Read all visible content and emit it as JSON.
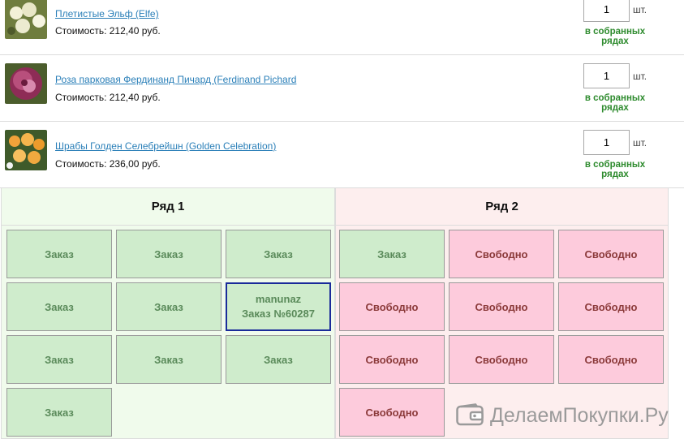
{
  "products": [
    {
      "name": "Плетистые Эльф (Elfe)",
      "price": "Стоимость: 212,40 руб.",
      "qty": "1",
      "unit": "шт.",
      "status_line1": "в собранных",
      "status_line2": "рядах"
    },
    {
      "name": "Роза парковая Фердинанд Пичард (Ferdinand Pichard",
      "price": "Стоимость: 212,40 руб.",
      "qty": "1",
      "unit": "шт.",
      "status_line1": "в собранных",
      "status_line2": "рядах"
    },
    {
      "name": "Шрабы Голден Селебрейшн (Golden Celebration)",
      "price": "Стоимость: 236,00 руб.",
      "qty": "1",
      "unit": "шт.",
      "status_line1": "в собранных",
      "status_line2": "рядах"
    }
  ],
  "rows": [
    {
      "title": "Ряд 1",
      "cells": [
        {
          "type": "order",
          "label": "Заказ"
        },
        {
          "type": "order",
          "label": "Заказ"
        },
        {
          "type": "order",
          "label": "Заказ"
        },
        {
          "type": "order",
          "label": "Заказ"
        },
        {
          "type": "order",
          "label": "Заказ"
        },
        {
          "type": "mine",
          "user": "manunaz",
          "label": "Заказ №60287"
        },
        {
          "type": "order",
          "label": "Заказ"
        },
        {
          "type": "order",
          "label": "Заказ"
        },
        {
          "type": "order",
          "label": "Заказ"
        },
        {
          "type": "order",
          "label": "Заказ"
        }
      ]
    },
    {
      "title": "Ряд 2",
      "cells": [
        {
          "type": "order",
          "label": "Заказ"
        },
        {
          "type": "free",
          "label": "Свободно"
        },
        {
          "type": "free",
          "label": "Свободно"
        },
        {
          "type": "free",
          "label": "Свободно"
        },
        {
          "type": "free",
          "label": "Свободно"
        },
        {
          "type": "free",
          "label": "Свободно"
        },
        {
          "type": "free",
          "label": "Свободно"
        },
        {
          "type": "free",
          "label": "Свободно"
        },
        {
          "type": "free",
          "label": "Свободно"
        },
        {
          "type": "free",
          "label": "Свободно"
        }
      ]
    }
  ],
  "watermark": {
    "text": "ДелаемПокупки.Ру",
    "icon": "wallet-icon"
  },
  "colors": {
    "link": "#2a7fb8",
    "status_green": "#2e8b2e",
    "order_bg": "#cfeccc",
    "free_bg": "#fdcbdc",
    "mine_border": "#1a2b9a"
  }
}
